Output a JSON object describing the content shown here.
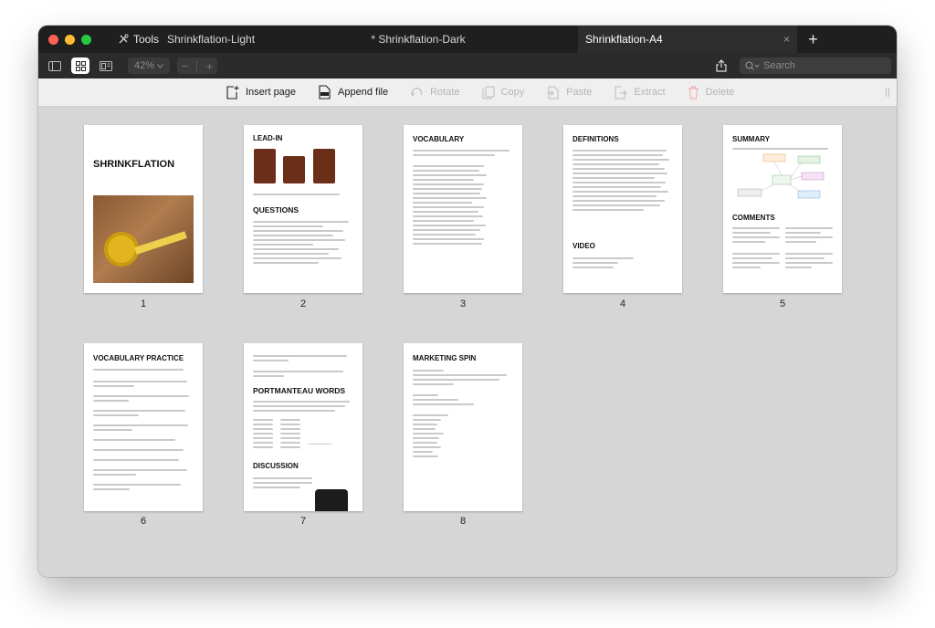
{
  "window": {
    "tools_label": "Tools",
    "tabs": [
      {
        "label": "Shrinkflation-Light"
      },
      {
        "label": "* Shrinkflation-Dark"
      },
      {
        "label": "Shrinkflation-A4"
      }
    ],
    "close_glyph": "×",
    "newtab_glyph": "+"
  },
  "toolbar": {
    "zoom": "42%",
    "zoom_out": "−",
    "zoom_in": "+",
    "search_placeholder": "Search"
  },
  "actions": [
    {
      "label": "Insert page",
      "enabled": true,
      "icon": "insert-page-icon"
    },
    {
      "label": "Append file",
      "enabled": true,
      "icon": "append-pdf-icon"
    },
    {
      "label": "Rotate",
      "enabled": false,
      "icon": "rotate-icon"
    },
    {
      "label": "Copy",
      "enabled": false,
      "icon": "copy-icon"
    },
    {
      "label": "Paste",
      "enabled": false,
      "icon": "paste-icon"
    },
    {
      "label": "Extract",
      "enabled": false,
      "icon": "extract-icon"
    },
    {
      "label": "Delete",
      "enabled": false,
      "icon": "trash-icon"
    }
  ],
  "pages": [
    {
      "number": "1",
      "heading": "SHRINKFLATION"
    },
    {
      "number": "2",
      "heading": "LEAD-IN",
      "subheading": "QUESTIONS"
    },
    {
      "number": "3",
      "heading": "VOCABULARY"
    },
    {
      "number": "4",
      "heading": "DEFINITIONS",
      "subheading": "VIDEO"
    },
    {
      "number": "5",
      "heading": "SUMMARY",
      "subheading": "COMMENTS"
    },
    {
      "number": "6",
      "heading": "VOCABULARY PRACTICE"
    },
    {
      "number": "7",
      "heading": "PORTMANTEAU WORDS",
      "subheading": "DISCUSSION"
    },
    {
      "number": "8",
      "heading": "MARKETING SPIN"
    }
  ],
  "colors": {
    "close": "#ff5f57",
    "minimize": "#febc2e",
    "zoom": "#28c840"
  }
}
